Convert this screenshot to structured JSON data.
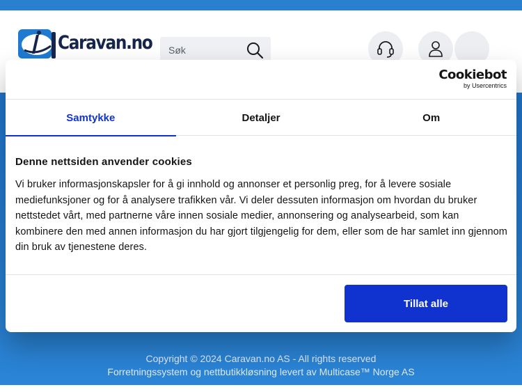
{
  "site": {
    "logo_text": "Caravan.no",
    "search_placeholder": "Søk"
  },
  "header": {
    "icons": [
      "headset-icon",
      "user-icon",
      "cart-icon"
    ]
  },
  "cookie_dialog": {
    "brand_name": "Cookiebot",
    "brand_sub": "by Usercentrics",
    "tabs": [
      {
        "label": "Samtykke",
        "active": true
      },
      {
        "label": "Detaljer",
        "active": false
      },
      {
        "label": "Om",
        "active": false
      }
    ],
    "title": "Denne nettsiden anvender cookies",
    "text": "Vi bruker informasjonskapsler for å gi innhold og annonser et personlig preg, for å levere sosiale mediefunksjoner og for å analysere trafikken vår. Vi deler dessuten informasjon om hvordan du bruker nettstedet vårt, med partnerne våre innen sosiale medier, annonsering og analysearbeid, som kan kombinere den med annen informasjon du har gjort tilgjengelig for dem, eller som de har samlet inn gjennom din bruk av tjenestene deres.",
    "allow_all_label": "Tillat alle"
  },
  "footer": {
    "copyright": "Copyright © 2024 Caravan.no AS - All rights reserved",
    "credit": "Forretningssystem og nettbutikkløsning levert av Multicase™ Norge AS"
  },
  "colors": {
    "accent": "#1032cf",
    "brand_blue": "#2a7fcf",
    "logo_navy": "#16254c"
  }
}
